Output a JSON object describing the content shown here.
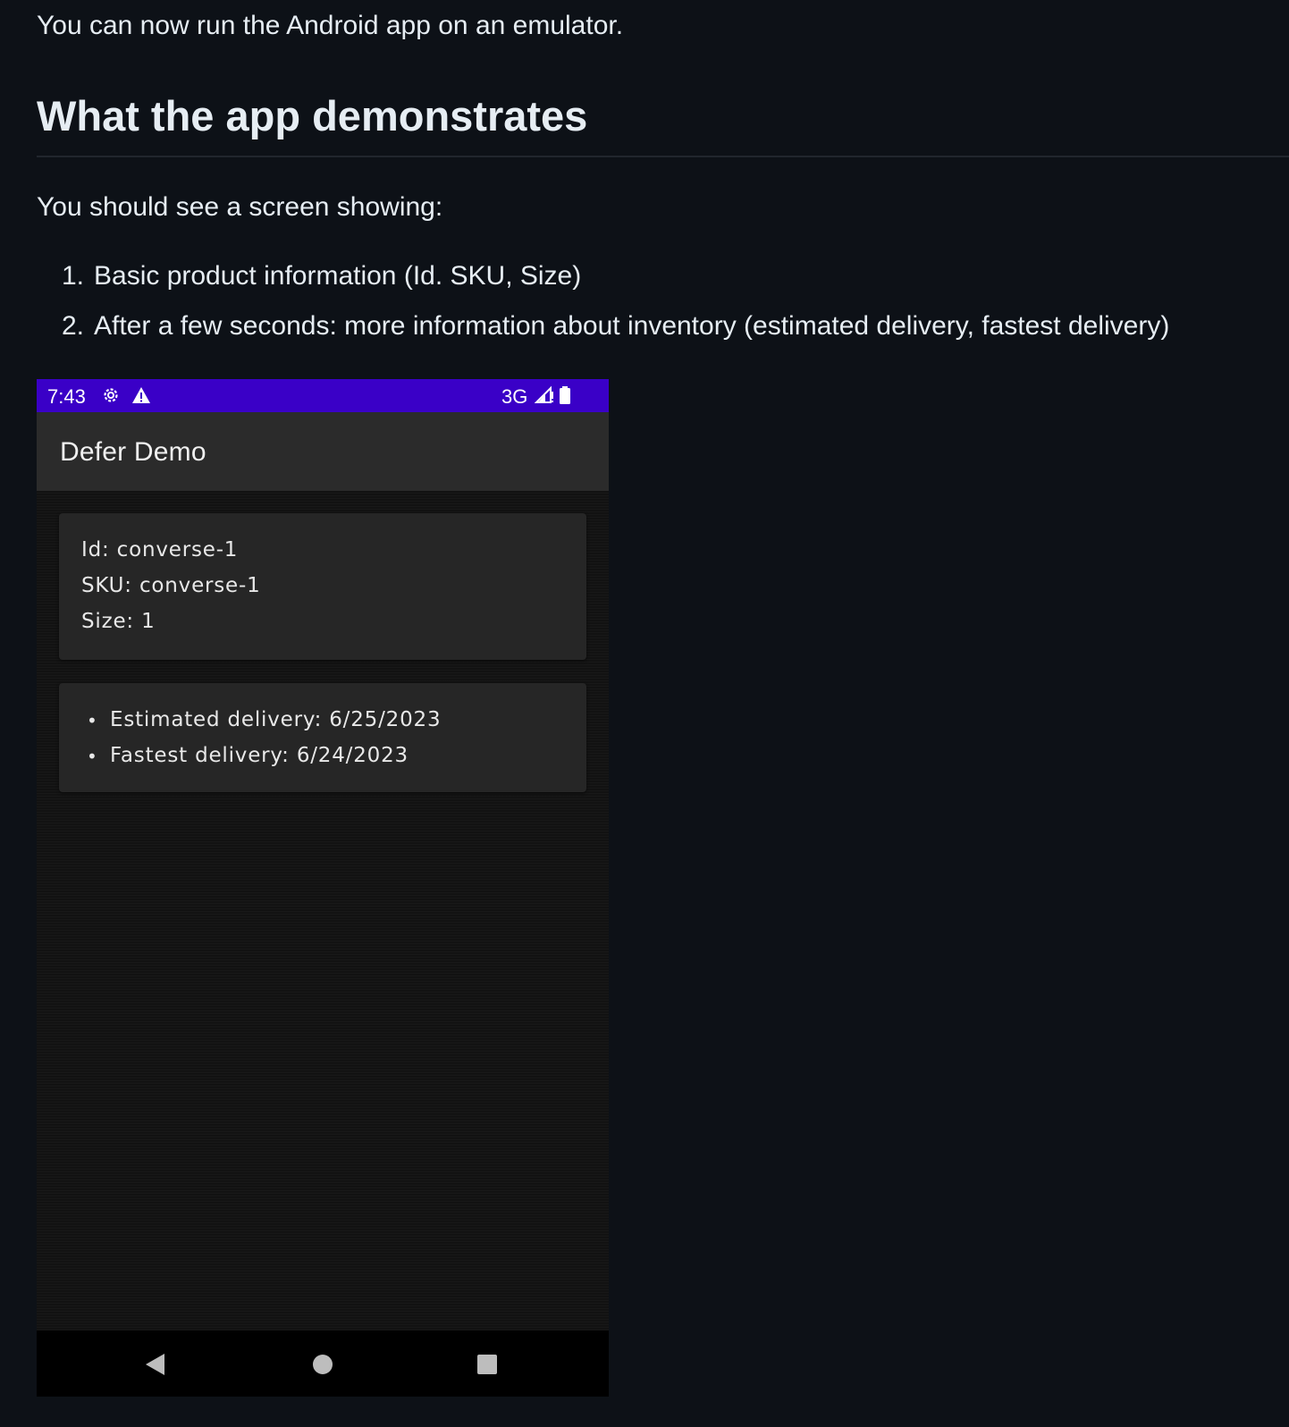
{
  "doc": {
    "intro": "You can now run the Android app on an emulator.",
    "heading": "What the app demonstrates",
    "lead": "You should see a screen showing:",
    "steps": [
      {
        "num": "1.",
        "text": "Basic product information (Id. SKU, Size)"
      },
      {
        "num": "2.",
        "text": "After a few seconds: more information about inventory (estimated delivery, fastest delivery)"
      }
    ]
  },
  "phone": {
    "status_bar": {
      "time": "7:43",
      "network": "3G",
      "color": "#3a00c7",
      "icons": [
        "settings-icon",
        "warning-icon",
        "signal-icon",
        "battery-icon"
      ]
    },
    "app_bar": {
      "title": "Defer Demo"
    },
    "product_card": {
      "id_line": "Id: converse-1",
      "sku_line": "SKU: converse-1",
      "size_line": "Size: 1"
    },
    "inventory_card": {
      "items": [
        "Estimated delivery: 6/25/2023",
        "Fastest delivery: 6/24/2023"
      ]
    },
    "nav_bar": {
      "icons": [
        "back-icon",
        "home-icon",
        "recents-icon"
      ]
    }
  }
}
